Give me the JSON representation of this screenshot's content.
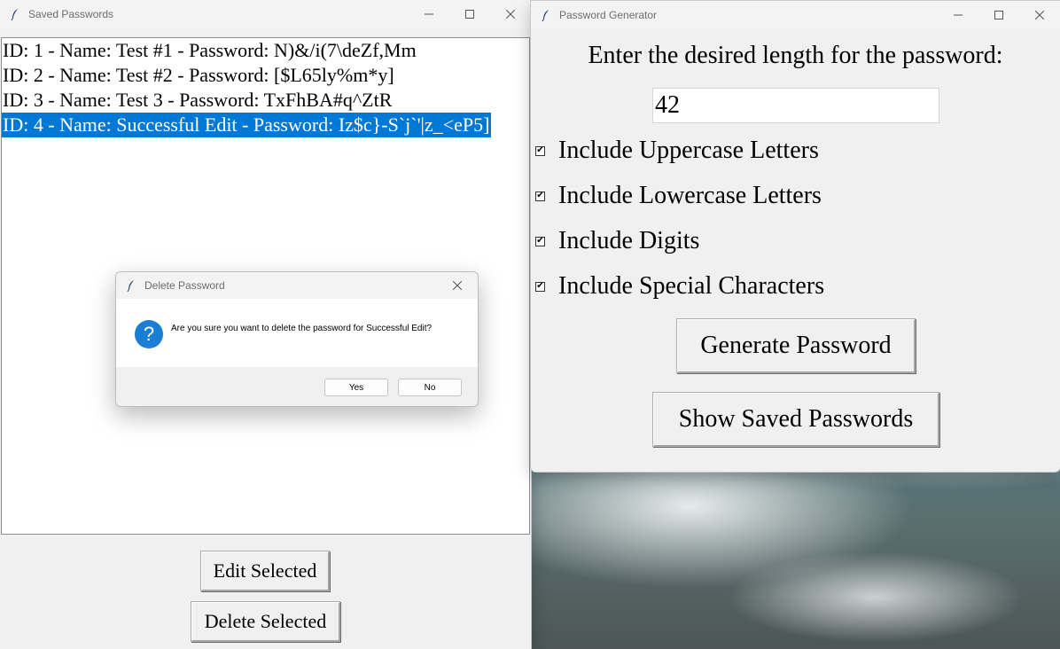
{
  "saved_window": {
    "title": "Saved Passwords",
    "entries": [
      "ID: 1 - Name: Test #1 - Password: N)&/i(7\\deZf,Mm",
      "ID: 2 - Name: Test #2 - Password: [$L65ly%m*y]",
      "ID: 3 - Name: Test 3 - Password: TxFhBA#q^ZtR",
      "ID: 4 - Name: Successful Edit - Password: Iz$c}-S`j`'|z_<eP5]"
    ],
    "selected_index": 3,
    "edit_label": "Edit Selected",
    "delete_label": "Delete Selected"
  },
  "generator_window": {
    "title": "Password Generator",
    "heading": "Enter the desired length for the password:",
    "length_value": "42",
    "options": [
      {
        "label": "Include Uppercase Letters",
        "checked": true
      },
      {
        "label": "Include Lowercase Letters",
        "checked": true
      },
      {
        "label": "Include Digits",
        "checked": true
      },
      {
        "label": "Include Special Characters",
        "checked": true
      }
    ],
    "generate_label": "Generate Password",
    "show_saved_label": "Show Saved Passwords"
  },
  "dialog": {
    "title": "Delete Password",
    "message": "Are you sure you want to delete the password for Successful Edit?",
    "yes_label": "Yes",
    "no_label": "No",
    "icon": "question-icon"
  },
  "colors": {
    "selection": "#0078d7",
    "question_icon": "#1a7fd4"
  }
}
